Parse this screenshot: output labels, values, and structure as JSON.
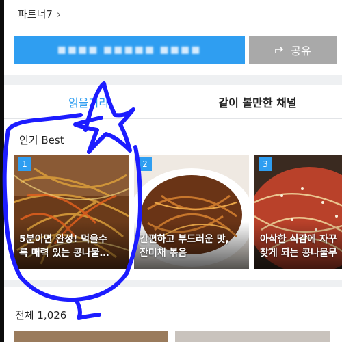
{
  "header": {
    "partner_label": "파트너7",
    "partner_chevron_icon": "chevron-right-icon",
    "subscribe_button_label": "■■■■ ■■■■■ ■■■■",
    "share_icon": "share-icon",
    "share_button_label": "공유"
  },
  "tabs": [
    {
      "label": "읽을거리",
      "active": true
    },
    {
      "label": "같이 볼만한 채널",
      "active": false
    }
  ],
  "popular": {
    "title": "인기 Best",
    "cards": [
      {
        "rank": "1",
        "caption": "5분이면 완성! 먹을수\n록 매력 있는 콩나물…"
      },
      {
        "rank": "2",
        "caption": "간편하고 부드러운 맛,\n잔미채 볶음"
      },
      {
        "rank": "3",
        "caption": "아삭한 식감에 자꾸\n찾게 되는 콩나물무"
      }
    ]
  },
  "all": {
    "label": "전체",
    "count": "1,026"
  },
  "colors": {
    "accent": "#2f9ef1",
    "share_bg": "#a9a9a9",
    "annotation": "#1c1cff"
  }
}
